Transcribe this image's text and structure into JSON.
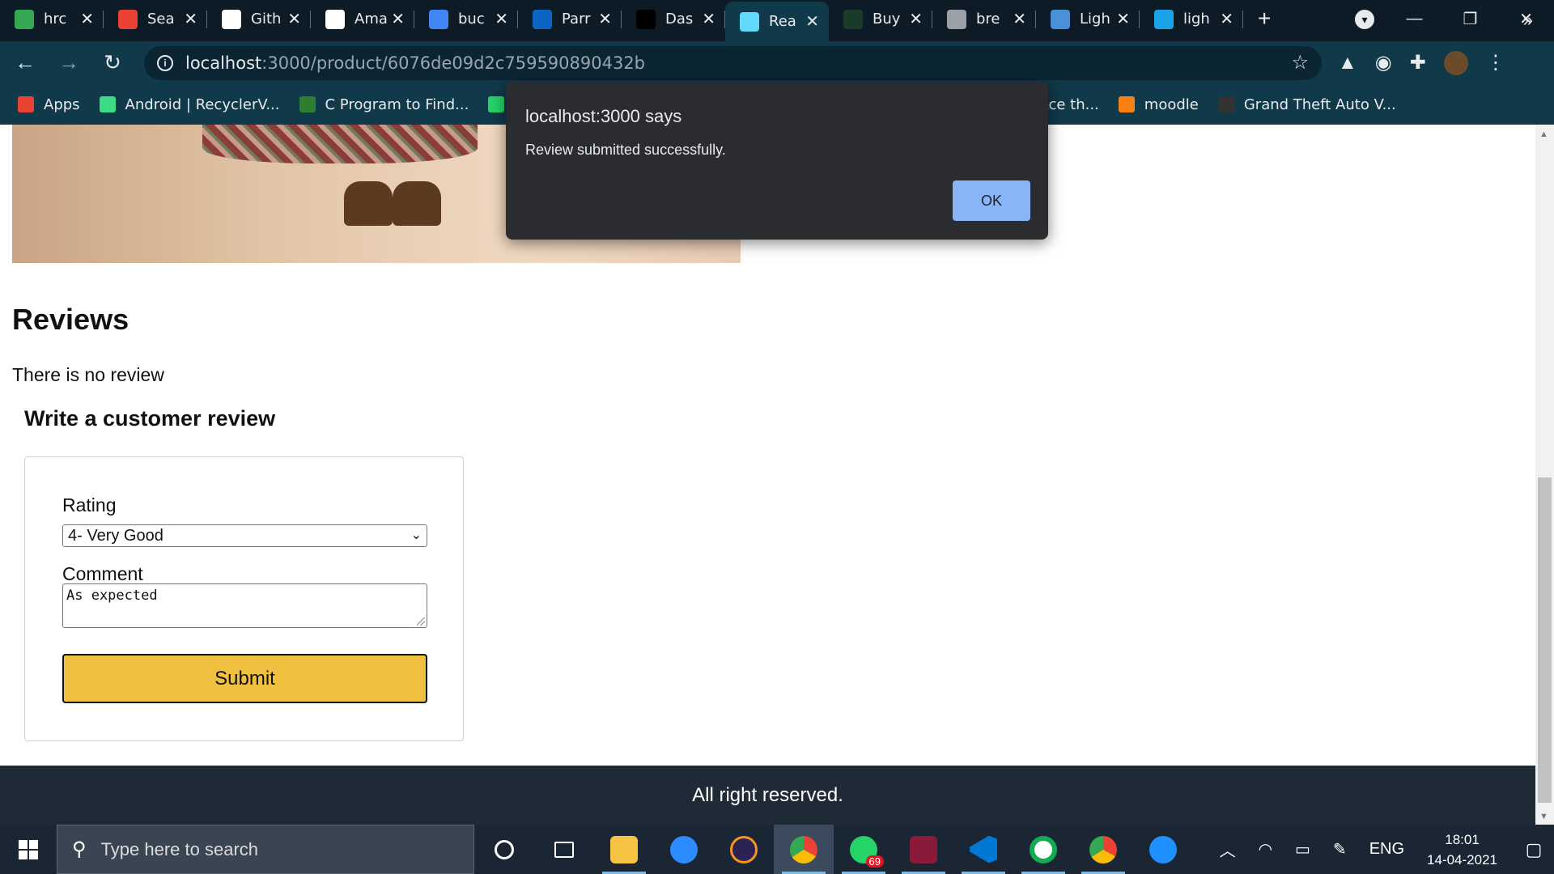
{
  "browser": {
    "tabs": [
      {
        "title": "hrc",
        "icon": "google-drive-icon",
        "color": "#34a853"
      },
      {
        "title": "Sea",
        "icon": "gmail-icon",
        "color": "#ea4335"
      },
      {
        "title": "Gith",
        "icon": "github-icon",
        "color": "#ffffff"
      },
      {
        "title": "Ama",
        "icon": "amazon-icon",
        "color": "#ffffff"
      },
      {
        "title": "buc",
        "icon": "google-icon",
        "color": "#4285f4"
      },
      {
        "title": "Parr",
        "icon": "linkedin-icon",
        "color": "#0a66c2"
      },
      {
        "title": "Das",
        "icon": "dashboard-icon",
        "color": "#000000"
      },
      {
        "title": "Rea",
        "icon": "react-icon",
        "color": "#61dafb"
      },
      {
        "title": "Buy",
        "icon": "shop-icon",
        "color": "#1a3a2a"
      },
      {
        "title": "bre",
        "icon": "globe-icon",
        "color": "#9aa0a6"
      },
      {
        "title": "Ligh",
        "icon": "colorzilla-icon",
        "color": "#4a90d9"
      },
      {
        "title": "ligh",
        "icon": "codecademy-icon",
        "color": "#1aa3e8"
      }
    ],
    "active_tab_index": 7,
    "url_host": "localhost",
    "url_path": ":3000/product/6076de09d2c759590890432b",
    "bookmarks": [
      {
        "label": "Apps",
        "icon": "apps-grid-icon",
        "color": "#ea4335"
      },
      {
        "label": "Android | RecyclerV...",
        "icon": "bookmark-site-icon",
        "color": "#3ddc84"
      },
      {
        "label": "C Program to Find...",
        "icon": "bookmark-site-icon",
        "color": "#2e7d32"
      },
      {
        "label": "(",
        "icon": "whatsapp-icon",
        "color": "#25d366"
      },
      {
        "label": "xpert | Ace th...",
        "icon": "bookmark-site-icon",
        "color": "#10394a"
      },
      {
        "label": "moodle",
        "icon": "moodle-icon",
        "color": "#f98012"
      },
      {
        "label": "Grand Theft Auto V...",
        "icon": "epic-games-icon",
        "color": "#333333"
      }
    ]
  },
  "dialog": {
    "title": "localhost:3000 says",
    "message": "Review submitted successfully.",
    "ok_label": "OK"
  },
  "page": {
    "reviews_heading": "Reviews",
    "no_review_text": "There is no review",
    "write_review_heading": "Write a customer review",
    "rating_label": "Rating",
    "rating_value": "4- Very Good",
    "comment_label": "Comment",
    "comment_value": "As expected",
    "submit_label": "Submit",
    "footer_text": "All right reserved.",
    "accent_color": "#f0c040"
  },
  "taskbar": {
    "search_placeholder": "Type here to search",
    "whatsapp_badge": "69",
    "language": "ENG",
    "time": "18:01",
    "date": "14-04-2021"
  }
}
